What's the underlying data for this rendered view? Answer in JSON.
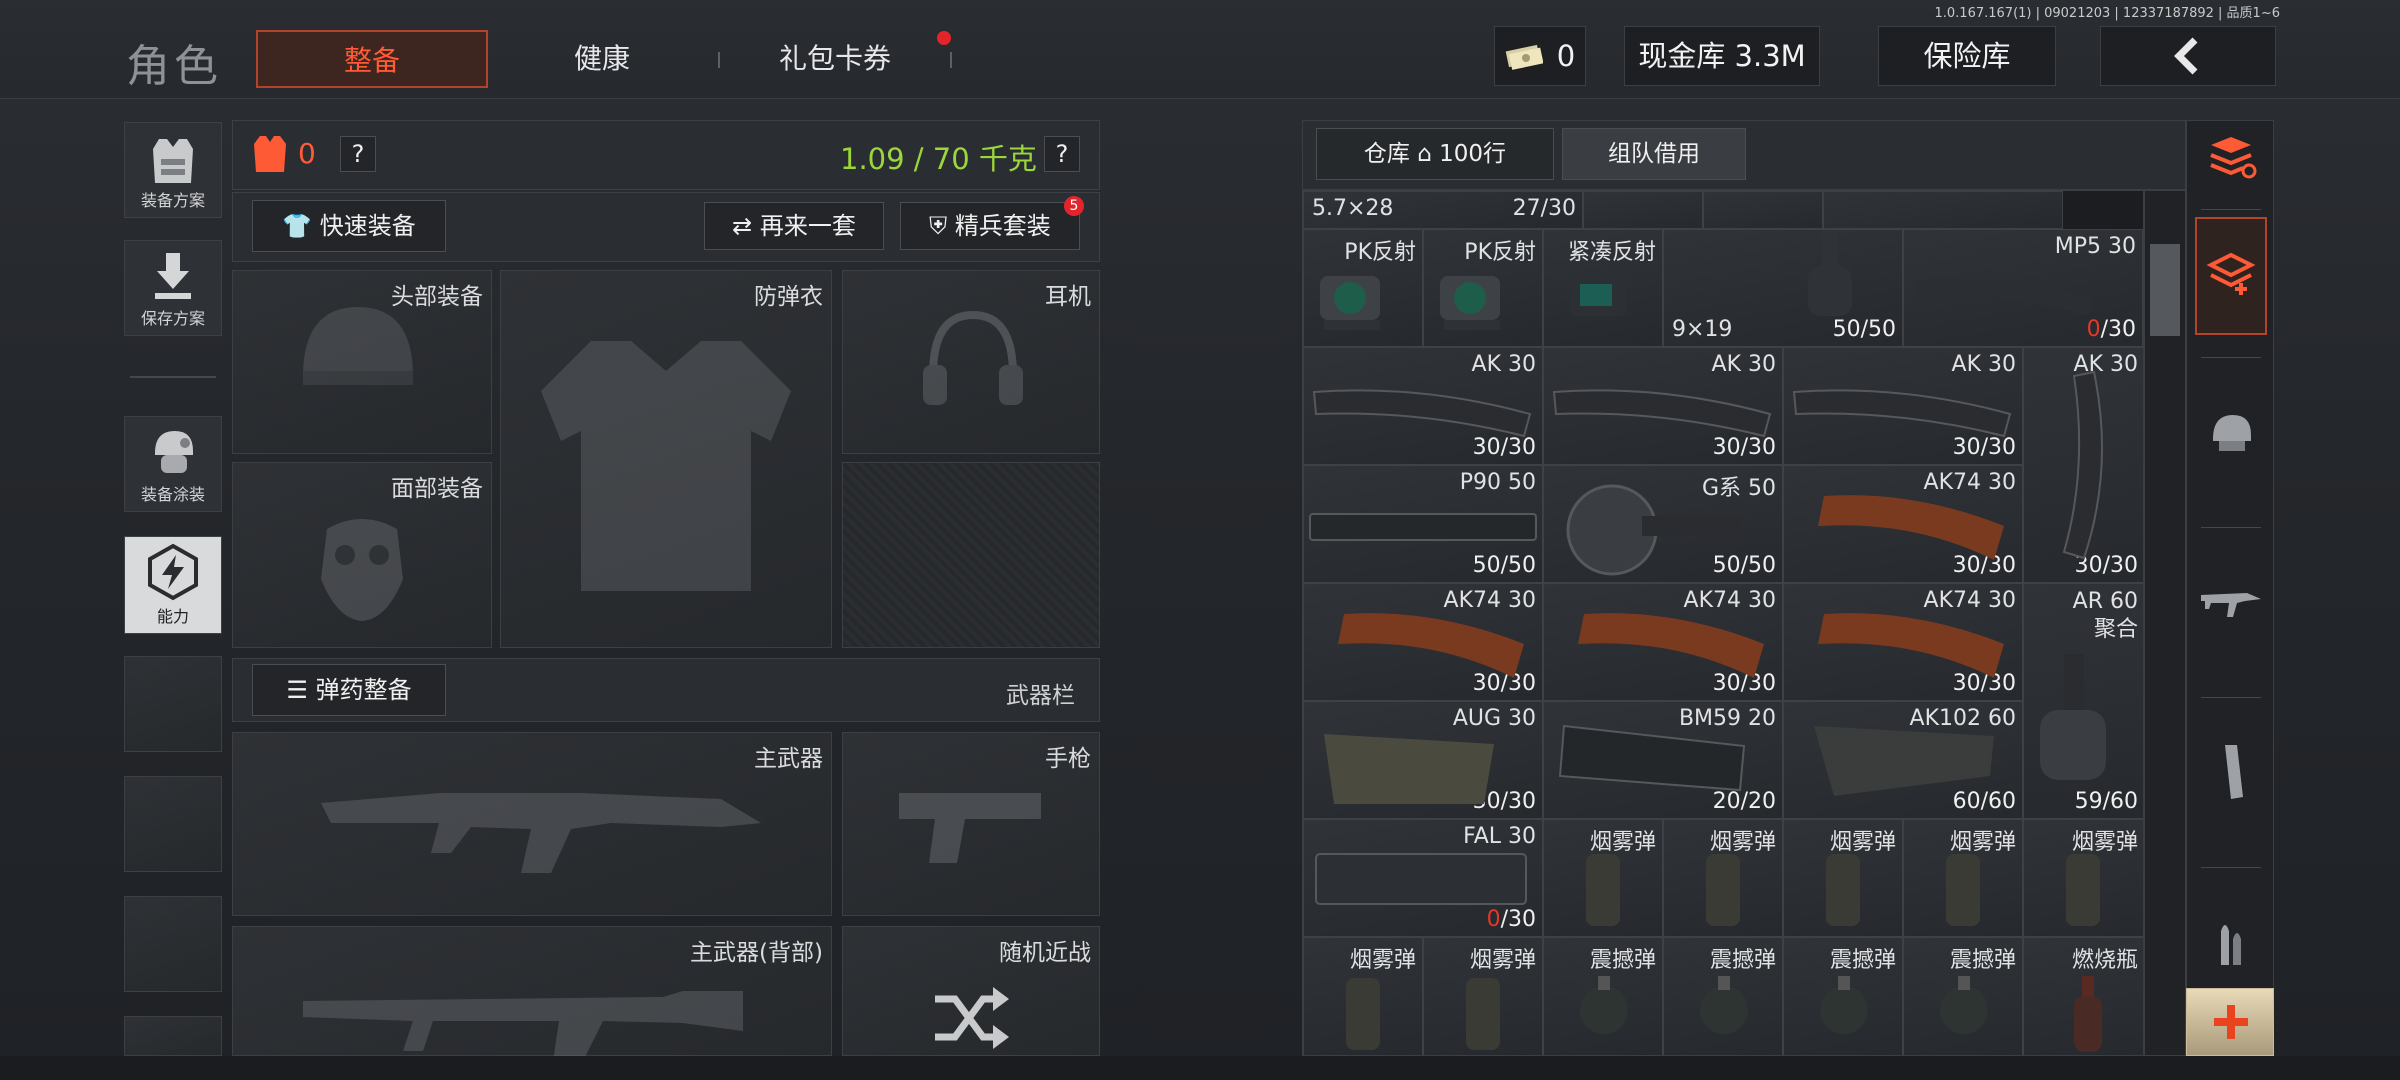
{
  "version": "1.0.167.167(1) | 09021203 | 12337187892 | 品质1~6",
  "header": {
    "title": "角色",
    "tabs": [
      {
        "label": "整备",
        "active": true
      },
      {
        "label": "健康",
        "active": false
      },
      {
        "label": "礼包卡券",
        "active": false,
        "badge_dot": true
      }
    ],
    "currency_value": "0",
    "cash_vault_label": "现金库 3.3M",
    "safe_label": "保险库",
    "back_icon": "chevron-left-icon"
  },
  "left_sidebar": [
    {
      "label": "装备方案",
      "icon": "vest-icon"
    },
    {
      "label": "保存方案",
      "icon": "download-icon"
    },
    {
      "label": "装备涂装",
      "icon": "helmet-paint-icon"
    },
    {
      "label": "能力",
      "icon": "lightning-hex-icon",
      "active": true
    }
  ],
  "loadout": {
    "armor_count": "0",
    "help": "?",
    "weight": "1.09 / 70 千克",
    "quick_equip": "快速装备",
    "again": "再来一套",
    "elite_set": "精兵套装",
    "elite_badge": "5",
    "slots": {
      "head": "头部装备",
      "body": "防弹衣",
      "ears": "耳机",
      "face": "面部装备"
    },
    "ammo_equip": "弹药整备",
    "weapon_bar": "武器栏",
    "primary": "主武器",
    "pistol": "手枪",
    "primary_back": "主武器(背部)",
    "melee": "随机近战"
  },
  "inventory": {
    "tab_storage": "仓库",
    "tab_storage_rows": "100行",
    "tab_team_borrow": "组队借用",
    "top_row": [
      {
        "name": "5.7×28",
        "count": "27/30"
      }
    ],
    "row1": [
      {
        "name": "PK反射"
      },
      {
        "name": "PK反射"
      },
      {
        "name": "紧凑反射"
      },
      {
        "name": "9×19",
        "count": "50/50"
      },
      {
        "name": "MP5 30",
        "count_red": "0",
        "count": "/30"
      }
    ],
    "row2": [
      {
        "name": "AK 30",
        "count": "30/30"
      },
      {
        "name": "AK 30",
        "count": "30/30"
      },
      {
        "name": "AK 30",
        "count": "30/30"
      },
      {
        "name": "AK 30",
        "count": "30/30"
      }
    ],
    "row3": [
      {
        "name": "P90 50",
        "count": "50/50"
      },
      {
        "name": "G系 50",
        "count": "50/50"
      },
      {
        "name": "AK74 30",
        "count": "30/30"
      }
    ],
    "row4": [
      {
        "name": "AK74 30",
        "count": "30/30"
      },
      {
        "name": "AK74 30",
        "count": "30/30"
      },
      {
        "name": "AK74 30",
        "count": "30/30"
      },
      {
        "name": "AR 60聚合",
        "count": "59/60"
      }
    ],
    "row5": [
      {
        "name": "AUG 30",
        "count": "30/30"
      },
      {
        "name": "BM59 20",
        "count": "20/20"
      },
      {
        "name": "AK102 60",
        "count": "60/60"
      }
    ],
    "row6": [
      {
        "name": "FAL 30",
        "count_red": "0",
        "count": "/30"
      },
      {
        "name": "烟雾弹"
      },
      {
        "name": "烟雾弹"
      },
      {
        "name": "烟雾弹"
      },
      {
        "name": "烟雾弹"
      },
      {
        "name": "烟雾弹"
      }
    ],
    "row7": [
      {
        "name": "烟雾弹"
      },
      {
        "name": "烟雾弹"
      },
      {
        "name": "震撼弹"
      },
      {
        "name": "震撼弹"
      },
      {
        "name": "震撼弹"
      },
      {
        "name": "震撼弹"
      },
      {
        "name": "燃烧瓶"
      }
    ]
  },
  "right_tools": [
    "sort-icon",
    "stack-icon",
    "helmet-icon",
    "rifle-icon",
    "magazine-icon",
    "ammo-icon",
    "plus-icon"
  ],
  "colors": {
    "accent": "#ff5a36",
    "weight_green": "#9bd63a",
    "badge_red": "#e3252b"
  }
}
